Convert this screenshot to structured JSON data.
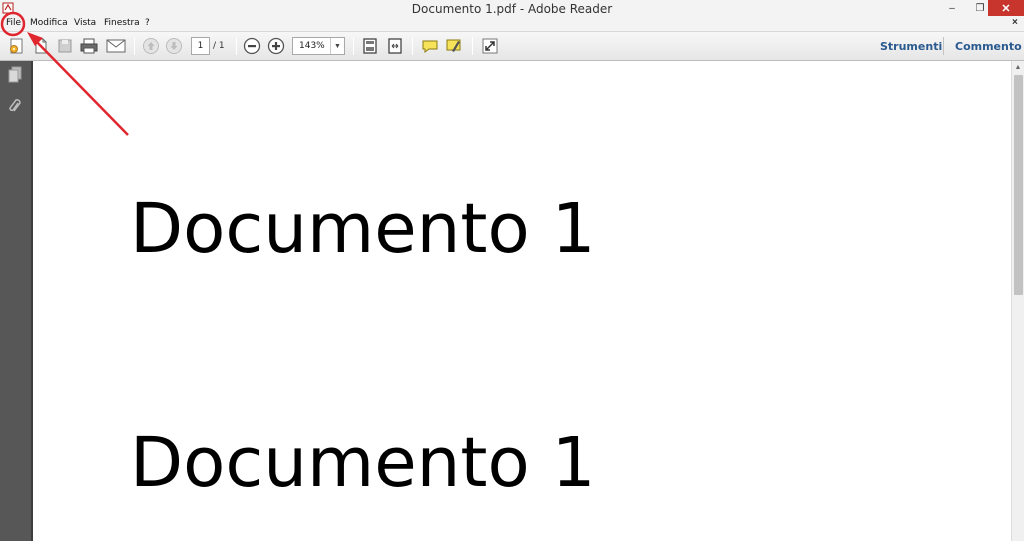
{
  "window": {
    "title": "Documento 1.pdf - Adobe Reader",
    "minimize_glyph": "–",
    "restore_glyph": "❐",
    "close_glyph": "✕"
  },
  "menu": {
    "items": [
      "File",
      "Modifica",
      "Vista",
      "Finestra",
      "?"
    ],
    "close_glyph": "×"
  },
  "toolbar": {
    "page_current": "1",
    "page_total": "/ 1",
    "zoom": "143%",
    "tools_label": "Strumenti",
    "comment_label": "Commento"
  },
  "document": {
    "lines": [
      "Documento 1",
      "Documento 1"
    ]
  },
  "colors": {
    "annotation": "#e0262f",
    "link": "#2a5a8f",
    "nav_panel": "#575757"
  },
  "icons": [
    "create-pdf-icon",
    "open-icon",
    "save-icon",
    "print-icon",
    "email-icon",
    "prev-page-icon",
    "next-page-icon",
    "zoom-out-icon",
    "zoom-in-icon",
    "fit-page-icon",
    "fit-width-icon",
    "comment-icon",
    "highlight-icon",
    "fullscreen-icon",
    "pages-icon",
    "attachment-icon"
  ]
}
